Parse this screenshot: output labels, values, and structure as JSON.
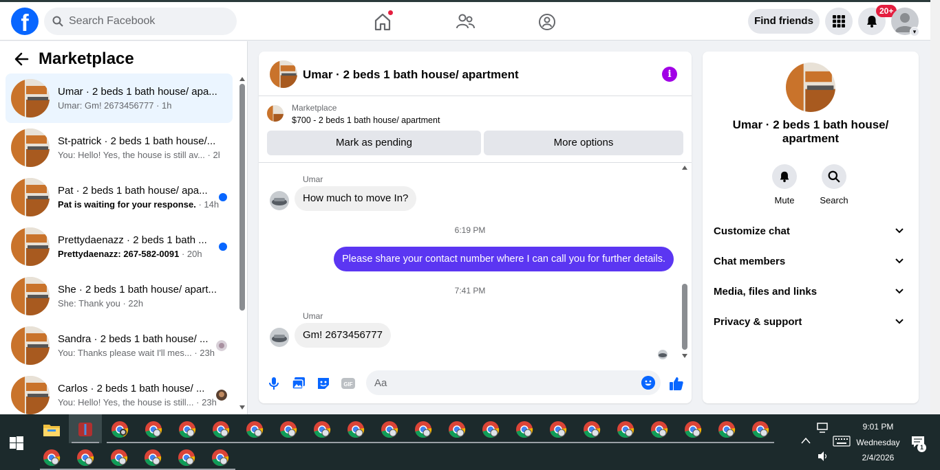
{
  "topbar": {
    "search_placeholder": "Search Facebook",
    "find_friends_label": "Find friends",
    "notification_count": "20+"
  },
  "sidebar": {
    "title": "Marketplace",
    "conversations": [
      {
        "title": "Umar · 2 beds 1 bath house/ apa...",
        "preview": "Umar: Gm! 2673456777",
        "time": "· 1h",
        "unread": false
      },
      {
        "title": "St-patrick · 2 beds 1 bath house/...",
        "preview": "You: Hello! Yes, the house is still av...",
        "time": "· 2h",
        "unread": false
      },
      {
        "title": "Pat · 2 beds 1 bath house/ apa...",
        "preview": "Pat is waiting for your response.",
        "time": "· 14h",
        "unread": true
      },
      {
        "title": "Prettydaenazz · 2 beds 1 bath ...",
        "preview": "Prettydaenazz: 267-582-0091",
        "time": "· 20h",
        "unread": true
      },
      {
        "title": "She · 2 beds 1 bath house/ apart...",
        "preview": "She: Thank you",
        "time": "· 22h",
        "unread": false
      },
      {
        "title": "Sandra · 2 beds 1 bath house/ ...",
        "preview": "You: Thanks please wait I'll mes...",
        "time": "· 23h",
        "unread": false
      },
      {
        "title": "Carlos · 2 beds 1 bath house/ ...",
        "preview": "You: Hello! Yes, the house is still...",
        "time": "· 23h",
        "unread": false
      }
    ]
  },
  "chat": {
    "title": "Umar · 2 beds 1 bath house/ apartment",
    "listing_source": "Marketplace",
    "listing_price_title": "$700 - 2 beds 1 bath house/ apartment",
    "mark_pending_label": "Mark as pending",
    "more_options_label": "More options",
    "messages": {
      "m1_sender": "Umar",
      "m1_text": "How much to move In?",
      "t1": "6:19 PM",
      "m2_text": "Please share your contact number where I can call you for further details.",
      "t2": "7:41 PM",
      "m3_sender": "Umar",
      "m3_text": "Gm! 2673456777"
    },
    "composer_placeholder": "Aa"
  },
  "info_panel": {
    "title": "Umar · 2 beds 1 bath house/ apartment",
    "mute_label": "Mute",
    "search_label": "Search",
    "sections": [
      "Customize chat",
      "Chat members",
      "Media, files and links",
      "Privacy & support"
    ]
  },
  "taskbar": {
    "time": "9:01 PM",
    "day": "Wednesday",
    "date": "2/4/2026",
    "notification_count": "1"
  },
  "colors": {
    "brand": "#0866ff",
    "outgoing_bubble": "#5b36f2",
    "info_icon": "#a100e6",
    "badge": "#e41e3f"
  }
}
